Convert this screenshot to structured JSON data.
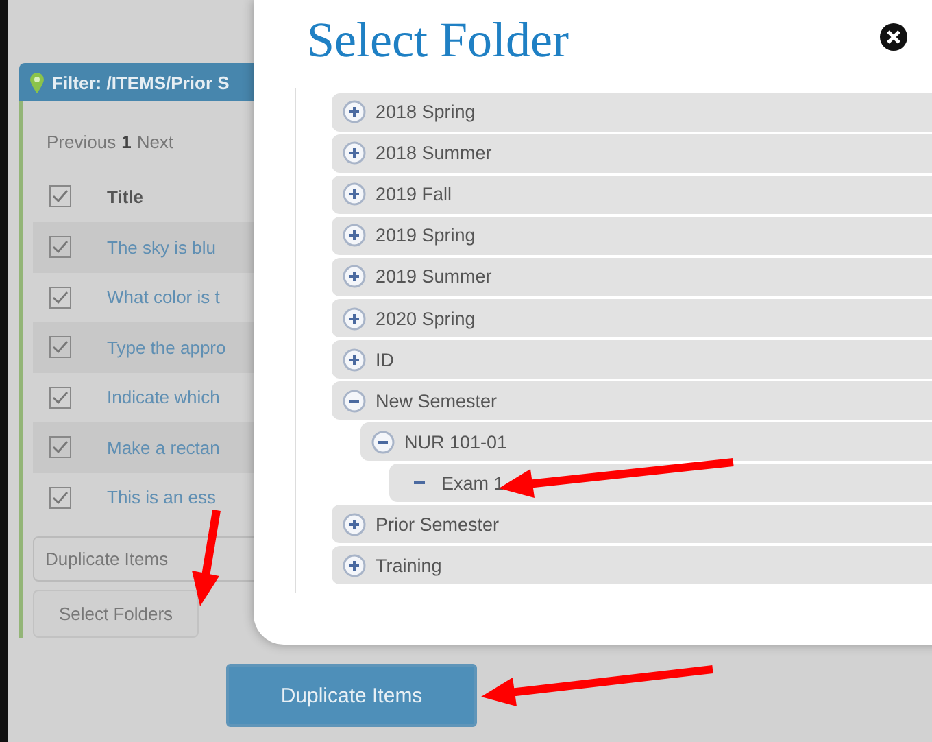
{
  "filter_panel": {
    "title": "Filter: /ITEMS/Prior S",
    "pager": {
      "previous": "Previous",
      "page": "1",
      "next": "Next"
    },
    "header": {
      "checked": true,
      "label": "Title"
    },
    "rows": [
      {
        "checked": true,
        "title": "The sky is blu"
      },
      {
        "checked": true,
        "title": "What color is t"
      },
      {
        "checked": true,
        "title": "Type the appro"
      },
      {
        "checked": true,
        "title": "Indicate which"
      },
      {
        "checked": true,
        "title": "Make a rectan"
      },
      {
        "checked": true,
        "title": "This is an ess"
      }
    ],
    "action_field": {
      "value": "Duplicate Items"
    },
    "select_button": "Select Folders"
  },
  "primary_button": "Duplicate Items",
  "modal": {
    "title": "Select Folder",
    "tree": [
      {
        "kind": "folder",
        "label": "2018 Spring",
        "expanded": false
      },
      {
        "kind": "folder",
        "label": "2018 Summer",
        "expanded": false
      },
      {
        "kind": "folder",
        "label": "2019 Fall",
        "expanded": false
      },
      {
        "kind": "folder",
        "label": "2019 Spring",
        "expanded": false
      },
      {
        "kind": "folder",
        "label": "2019 Summer",
        "expanded": false
      },
      {
        "kind": "folder",
        "label": "2020 Spring",
        "expanded": false
      },
      {
        "kind": "folder",
        "label": "ID",
        "expanded": false
      },
      {
        "kind": "folder",
        "label": "New Semester",
        "expanded": true,
        "children": [
          {
            "kind": "folder",
            "label": "NUR 101-01",
            "expanded": true,
            "children": [
              {
                "kind": "leaf",
                "label": "Exam 1"
              }
            ]
          }
        ]
      },
      {
        "kind": "folder",
        "label": "Prior Semester",
        "expanded": false
      },
      {
        "kind": "folder",
        "label": "Training",
        "expanded": false
      }
    ]
  }
}
